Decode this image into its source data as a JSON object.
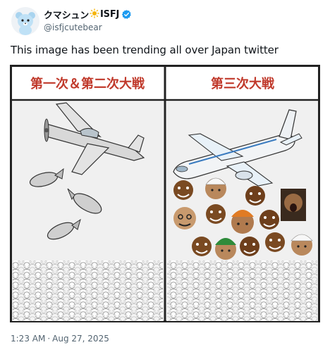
{
  "author": {
    "display_name_a": "クマシュン",
    "display_name_b": "ISFJ",
    "handle": "@isfjcutebear",
    "verified_icon": "verified-check-icon"
  },
  "tweet": {
    "text": "This image has been trending all over Japan twitter",
    "time": "1:23 AM",
    "separator": "·",
    "date": "Aug 27, 2025"
  },
  "media": {
    "left_title": "第一次＆第二次大戦",
    "right_title": "第三次大戦"
  },
  "colors": {
    "title_red": "#c0392b",
    "verified_blue": "#1d9bf0",
    "muted": "#536471"
  }
}
